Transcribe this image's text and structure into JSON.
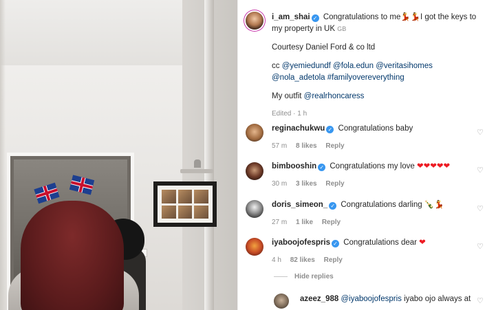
{
  "post": {
    "author": "i_am_shai",
    "caption_line1": "Congratulations to me💃💃I got the keys to my property in UK",
    "caption_flag": "GB",
    "courtesy": "Courtesy Daniel Ford & co ltd",
    "cc_prefix": "cc",
    "mentions": [
      "@yemiedundf",
      "@fola.edun",
      "@veritasihomes",
      "@nola_adetola"
    ],
    "hashtag": "#familyovereverything",
    "outfit_prefix": "My outfit",
    "outfit_mention": "@realrhoncaress",
    "edited": "Edited · 1 h"
  },
  "comments": [
    {
      "user": "reginachukwu",
      "verified": true,
      "text": "Congratulations baby",
      "hearts": "",
      "time": "57 m",
      "likes": "8 likes",
      "reply": "Reply"
    },
    {
      "user": "bimbooshin",
      "verified": true,
      "text": "Congratulations my love",
      "hearts": "❤❤❤❤❤",
      "time": "30 m",
      "likes": "3 likes",
      "reply": "Reply"
    },
    {
      "user": "doris_simeon_",
      "verified": true,
      "text": "Congratulations darling",
      "hearts": "🍾💃",
      "time": "27 m",
      "likes": "1 like",
      "reply": "Reply"
    },
    {
      "user": "iyaboojofespris",
      "verified": true,
      "text": "Congratulations dear",
      "hearts": "❤",
      "time": "4 h",
      "likes": "82 likes",
      "reply": "Reply"
    }
  ],
  "hide_replies": "Hide replies",
  "reply_comment": {
    "user": "azeez_988",
    "mention": "@iyaboojofespris",
    "text": "iyabo ojo always at"
  },
  "icons": {
    "verified": "verified-badge-icon",
    "like": "heart-outline-icon"
  },
  "colors": {
    "link": "#00376b",
    "verified": "#3897f0",
    "meta": "#8e8e8e",
    "heart": "#ed1c24"
  }
}
